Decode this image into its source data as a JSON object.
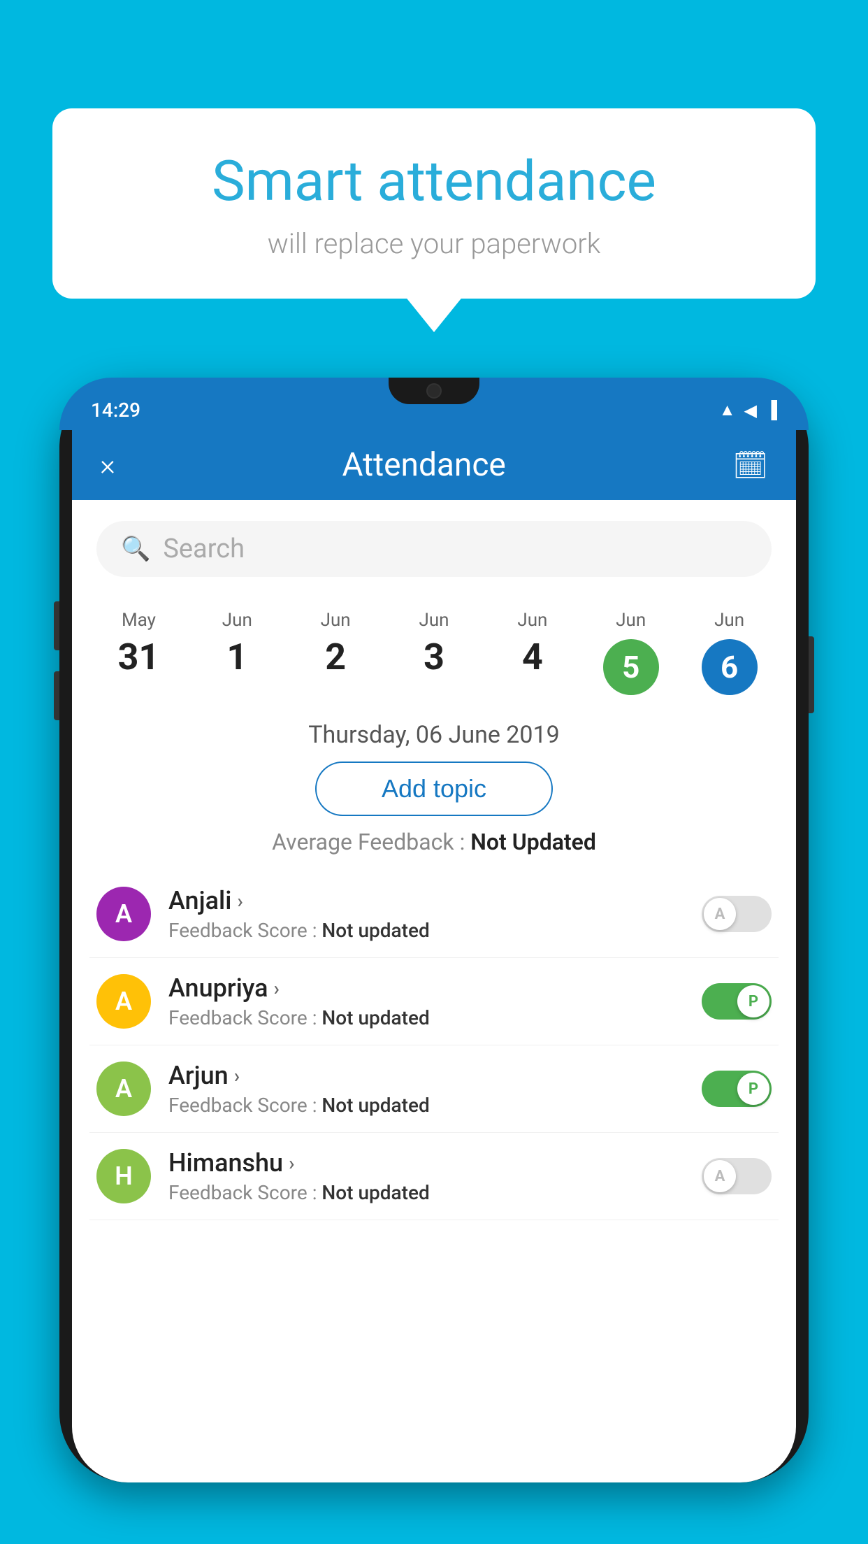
{
  "background_color": "#00B8E0",
  "bubble": {
    "title": "Smart attendance",
    "subtitle": "will replace your paperwork"
  },
  "status_bar": {
    "time": "14:29",
    "icons": [
      "wifi",
      "signal",
      "battery"
    ]
  },
  "header": {
    "close_label": "×",
    "title": "Attendance",
    "calendar_icon": "📅"
  },
  "search": {
    "placeholder": "Search"
  },
  "dates": [
    {
      "month": "May",
      "day": "31",
      "state": "normal"
    },
    {
      "month": "Jun",
      "day": "1",
      "state": "normal"
    },
    {
      "month": "Jun",
      "day": "2",
      "state": "normal"
    },
    {
      "month": "Jun",
      "day": "3",
      "state": "normal"
    },
    {
      "month": "Jun",
      "day": "4",
      "state": "normal"
    },
    {
      "month": "Jun",
      "day": "5",
      "state": "today"
    },
    {
      "month": "Jun",
      "day": "6",
      "state": "selected"
    }
  ],
  "selected_date_label": "Thursday, 06 June 2019",
  "add_topic_label": "Add topic",
  "avg_feedback_label": "Average Feedback : ",
  "avg_feedback_value": "Not Updated",
  "students": [
    {
      "name": "Anjali",
      "feedback_label": "Feedback Score : ",
      "feedback_value": "Not updated",
      "avatar_letter": "A",
      "avatar_color": "#9C27B0",
      "toggle_state": "off",
      "toggle_letter": "A"
    },
    {
      "name": "Anupriya",
      "feedback_label": "Feedback Score : ",
      "feedback_value": "Not updated",
      "avatar_letter": "A",
      "avatar_color": "#FFC107",
      "toggle_state": "on",
      "toggle_letter": "P"
    },
    {
      "name": "Arjun",
      "feedback_label": "Feedback Score : ",
      "feedback_value": "Not updated",
      "avatar_letter": "A",
      "avatar_color": "#8BC34A",
      "toggle_state": "on",
      "toggle_letter": "P"
    },
    {
      "name": "Himanshu",
      "feedback_label": "Feedback Score : ",
      "feedback_value": "Not updated",
      "avatar_letter": "H",
      "avatar_color": "#8BC34A",
      "toggle_state": "off",
      "toggle_letter": "A"
    }
  ]
}
